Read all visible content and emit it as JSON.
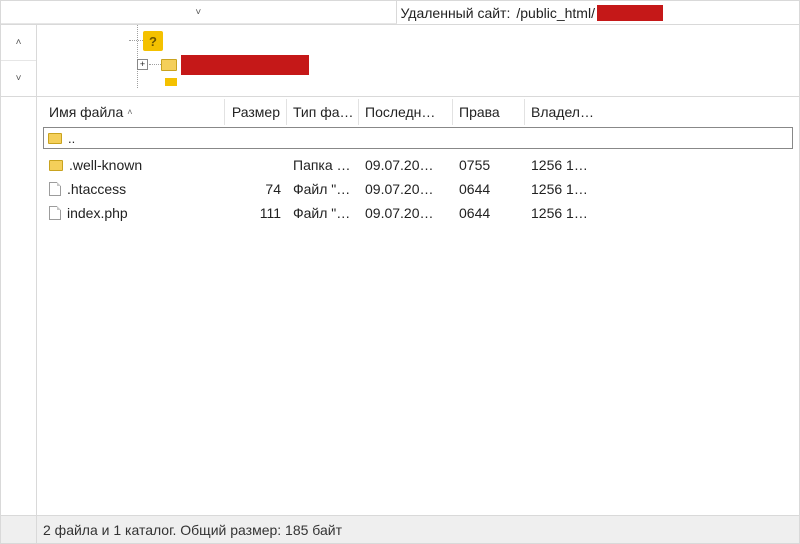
{
  "address": {
    "label": "Удаленный сайт:",
    "path_visible": "/public_html/",
    "redacted": true
  },
  "tree": {
    "root_kind": "unknown-folder",
    "child_kind": "folder",
    "expander": "+"
  },
  "columns": {
    "name": "Имя файла",
    "size": "Размер",
    "type": "Тип фа…",
    "mod": "Последн…",
    "perm": "Права",
    "owner": "Владел…"
  },
  "parent_row": {
    "name": ".."
  },
  "files": [
    {
      "icon": "folder",
      "name": ".well-known",
      "size": "",
      "type": "Папка …",
      "mod": "09.07.20…",
      "perm": "0755",
      "owner": "1256 1…"
    },
    {
      "icon": "file",
      "name": ".htaccess",
      "size": "74",
      "type": "Файл \"…",
      "mod": "09.07.20…",
      "perm": "0644",
      "owner": "1256 1…"
    },
    {
      "icon": "file",
      "name": "index.php",
      "size": "111",
      "type": "Файл \"…",
      "mod": "09.07.20…",
      "perm": "0644",
      "owner": "1256 1…"
    }
  ],
  "status": "2 файла и 1 каталог. Общий размер: 185 байт",
  "glyphs": {
    "up": "˄",
    "down": "˅",
    "caret": "˄",
    "dropdown": "˅"
  }
}
